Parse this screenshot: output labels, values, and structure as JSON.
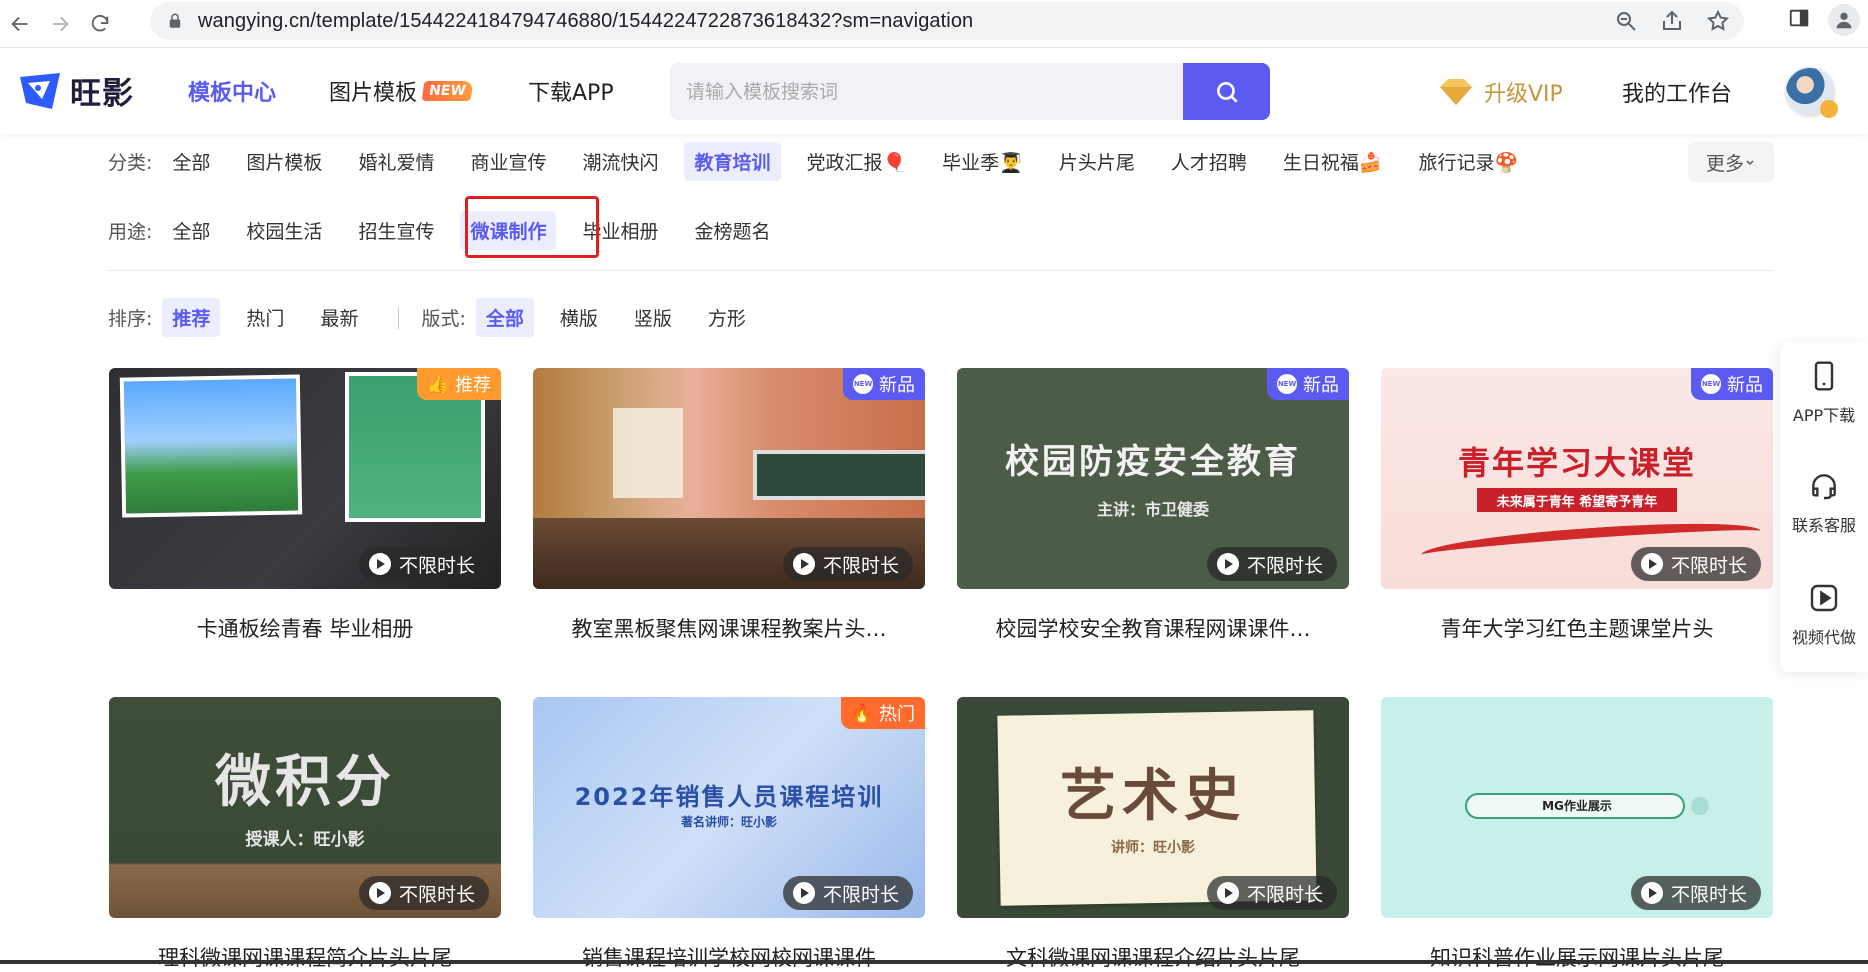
{
  "browser": {
    "url": "wangying.cn/template/1544224184794746880/1544224722873618432?sm=navigation"
  },
  "header": {
    "logo_text": "旺影",
    "nav": [
      {
        "label": "模板中心",
        "active": true
      },
      {
        "label": "图片模板",
        "badge": "NEW"
      },
      {
        "label": "下载APP"
      }
    ],
    "search_placeholder": "请输入模板搜索词",
    "vip_label": "升级VIP",
    "workbench_label": "我的工作台"
  },
  "filters": {
    "category_label": "分类:",
    "categories": [
      {
        "label": "全部"
      },
      {
        "label": "图片模板"
      },
      {
        "label": "婚礼爱情"
      },
      {
        "label": "商业宣传"
      },
      {
        "label": "潮流快闪"
      },
      {
        "label": "教育培训",
        "active": true
      },
      {
        "label": "党政汇报🎈"
      },
      {
        "label": "毕业季👨‍🎓"
      },
      {
        "label": "片头片尾"
      },
      {
        "label": "人才招聘"
      },
      {
        "label": "生日祝福🍰"
      },
      {
        "label": "旅行记录🍄"
      }
    ],
    "more_label": "更多",
    "usage_label": "用途:",
    "usages": [
      {
        "label": "全部"
      },
      {
        "label": "校园生活"
      },
      {
        "label": "招生宣传"
      },
      {
        "label": "微课制作",
        "active": true
      },
      {
        "label": "毕业相册"
      },
      {
        "label": "金榜题名"
      }
    ],
    "sort_label": "排序:",
    "sorts": [
      {
        "label": "推荐",
        "active": true
      },
      {
        "label": "热门"
      },
      {
        "label": "最新"
      }
    ],
    "format_label": "版式:",
    "formats": [
      {
        "label": "全部",
        "active": true
      },
      {
        "label": "横版"
      },
      {
        "label": "竖版"
      },
      {
        "label": "方形"
      }
    ]
  },
  "cards": [
    {
      "title": "卡通板绘青春 毕业相册",
      "badge": "推荐",
      "badge_type": "rec",
      "duration": "不限时长",
      "thumb_text": ""
    },
    {
      "title": "教室黑板聚焦网课课程教案片头…",
      "badge": "新品",
      "badge_type": "new",
      "duration": "不限时长",
      "thumb_text": ""
    },
    {
      "title": "校园学校安全教育课程网课课件…",
      "badge": "新品",
      "badge_type": "new",
      "duration": "不限时长",
      "thumb_text": "校园防疫安全教育",
      "thumb_sub": "主讲：市卫健委"
    },
    {
      "title": "青年大学习红色主题课堂片头",
      "badge": "新品",
      "badge_type": "new",
      "duration": "不限时长",
      "thumb_text": "青年学习大课堂",
      "thumb_sub": "未来属于青年 希望寄予青年"
    },
    {
      "title": "理科微课网课课程简介片头片尾",
      "badge": "",
      "badge_type": "",
      "duration": "不限时长",
      "thumb_text": "微积分",
      "thumb_sub": "授课人：旺小影"
    },
    {
      "title": "销售课程培训学校网校网课课件",
      "badge": "热门",
      "badge_type": "hot",
      "duration": "不限时长",
      "thumb_text": "2022年销售人员课程培训",
      "thumb_sub": "著名讲师：旺小影"
    },
    {
      "title": "文科微课网课课程介绍片头片尾",
      "badge": "",
      "badge_type": "",
      "duration": "不限时长",
      "thumb_text": "艺术史",
      "thumb_sub": "讲师：旺小影"
    },
    {
      "title": "知识科普作业展示网课片头片尾",
      "badge": "",
      "badge_type": "",
      "duration": "不限时长",
      "thumb_text": "MG作业展示",
      "thumb_sub": ""
    }
  ],
  "side_panel": [
    {
      "label": "APP下载",
      "icon": "phone-icon"
    },
    {
      "label": "联系客服",
      "icon": "headset-icon"
    },
    {
      "label": "视频代做",
      "icon": "video-play-icon"
    }
  ],
  "new_badge_icon_text": "NEW"
}
